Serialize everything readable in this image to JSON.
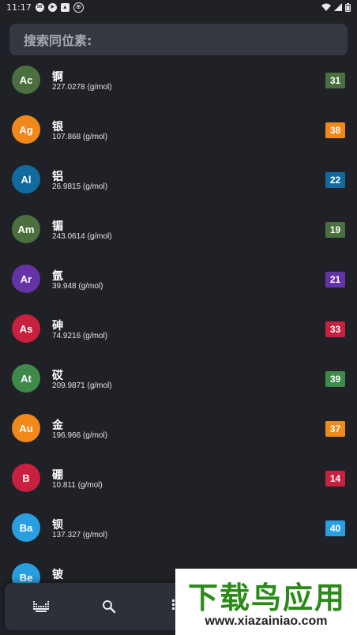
{
  "status_bar": {
    "time": "11:17",
    "left_icons": [
      "messages-icon",
      "telegram-icon",
      "cat-icon",
      "vpn-icon"
    ],
    "right_icons": [
      "wifi-icon",
      "signal-icon",
      "battery-icon"
    ]
  },
  "search": {
    "placeholder": "搜索同位素:"
  },
  "elements": [
    {
      "symbol": "Ac",
      "name": "锕",
      "mass": "227.0278 (g/mol)",
      "count": "31",
      "color": "#4b6f3e"
    },
    {
      "symbol": "Ag",
      "name": "银",
      "mass": "107.868 (g/mol)",
      "count": "38",
      "color": "#f0891a"
    },
    {
      "symbol": "Al",
      "name": "铝",
      "mass": "26.9815 (g/mol)",
      "count": "22",
      "color": "#126b9e"
    },
    {
      "symbol": "Am",
      "name": "镅",
      "mass": "243.0614 (g/mol)",
      "count": "19",
      "color": "#4b6f3e"
    },
    {
      "symbol": "Ar",
      "name": "氩",
      "mass": "39.948 (g/mol)",
      "count": "21",
      "color": "#6533a6"
    },
    {
      "symbol": "As",
      "name": "砷",
      "mass": "74.9216 (g/mol)",
      "count": "33",
      "color": "#c8203f"
    },
    {
      "symbol": "At",
      "name": "砹",
      "mass": "209.9871 (g/mol)",
      "count": "39",
      "color": "#3f8a4a"
    },
    {
      "symbol": "Au",
      "name": "金",
      "mass": "196.966 (g/mol)",
      "count": "37",
      "color": "#f0891a"
    },
    {
      "symbol": "B",
      "name": "硼",
      "mass": "10.811 (g/mol)",
      "count": "14",
      "color": "#c8203f"
    },
    {
      "symbol": "Ba",
      "name": "钡",
      "mass": "137.327 (g/mol)",
      "count": "40",
      "color": "#2a9fe0"
    },
    {
      "symbol": "Be",
      "name": "铍",
      "mass": "",
      "count": "",
      "color": "#2a9fe0"
    }
  ],
  "bottom_nav": {
    "items": [
      {
        "icon": "periodic-table-icon"
      },
      {
        "icon": "search-icon"
      },
      {
        "icon": "grid-dots-icon"
      }
    ]
  },
  "watermark": {
    "title": "下载鸟应用",
    "url": "www.xiazainiao.com"
  }
}
